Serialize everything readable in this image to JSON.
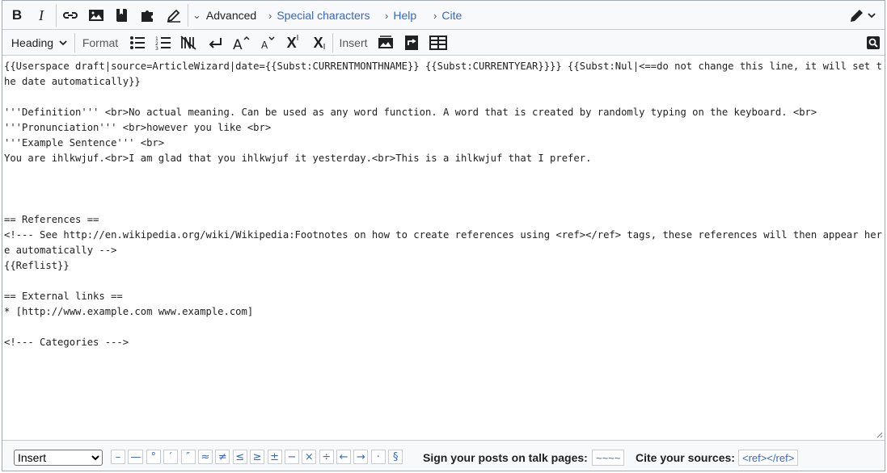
{
  "toolbar_main": {
    "bold_label": "B",
    "italic_label": "I",
    "advanced_label": "Advanced",
    "special_characters_label": "Special characters",
    "help_label": "Help",
    "cite_label": "Cite"
  },
  "toolbar_advanced": {
    "heading_label": "Heading",
    "format_label": "Format",
    "insert_label": "Insert",
    "superscript_label": "X",
    "subscript_label": "X"
  },
  "editor": {
    "content": "{{Userspace draft|source=ArticleWizard|date={{Subst:CURRENTMONTHNAME}} {{Subst:CURRENTYEAR}}}} {{Subst:Nul|<==do not change this line, it will set the date automatically}}\n\n'''Definition''' <br>No actual meaning. Can be used as any word function. A word that is created by randomly typing on the keyboard. <br>\n'''Pronunciation''' <br>however you like <br>\n'''Example Sentence''' <br>\nYou are ihlkwjuf.<br>I am glad that you ihlkwjuf it yesterday.<br>This is a ihlkwjuf that I prefer.\n\n\n\n== References ==\n<!--- See http://en.wikipedia.org/wiki/Wikipedia:Footnotes on how to create references using <ref></ref> tags, these references will then appear here automatically -->\n{{Reflist}}\n\n== External links ==\n* [http://www.example.com www.example.com]\n\n<!--- Categories --->"
  },
  "footer": {
    "insert_select_value": "Insert",
    "special_chars": [
      "–",
      "—",
      "°",
      "′",
      "″",
      "≈",
      "≠",
      "≤",
      "≥",
      "±",
      "−",
      "×",
      "÷",
      "←",
      "→",
      "·",
      "§"
    ],
    "sign_label": "Sign your posts on talk pages:",
    "sign_button": "~~~~",
    "cite_label": "Cite your sources:",
    "cite_button": "<ref></ref>"
  },
  "colors": {
    "link_blue": "#3366cc",
    "toolbar_bg": "#f8f9fa",
    "border": "#c8ccd1"
  }
}
